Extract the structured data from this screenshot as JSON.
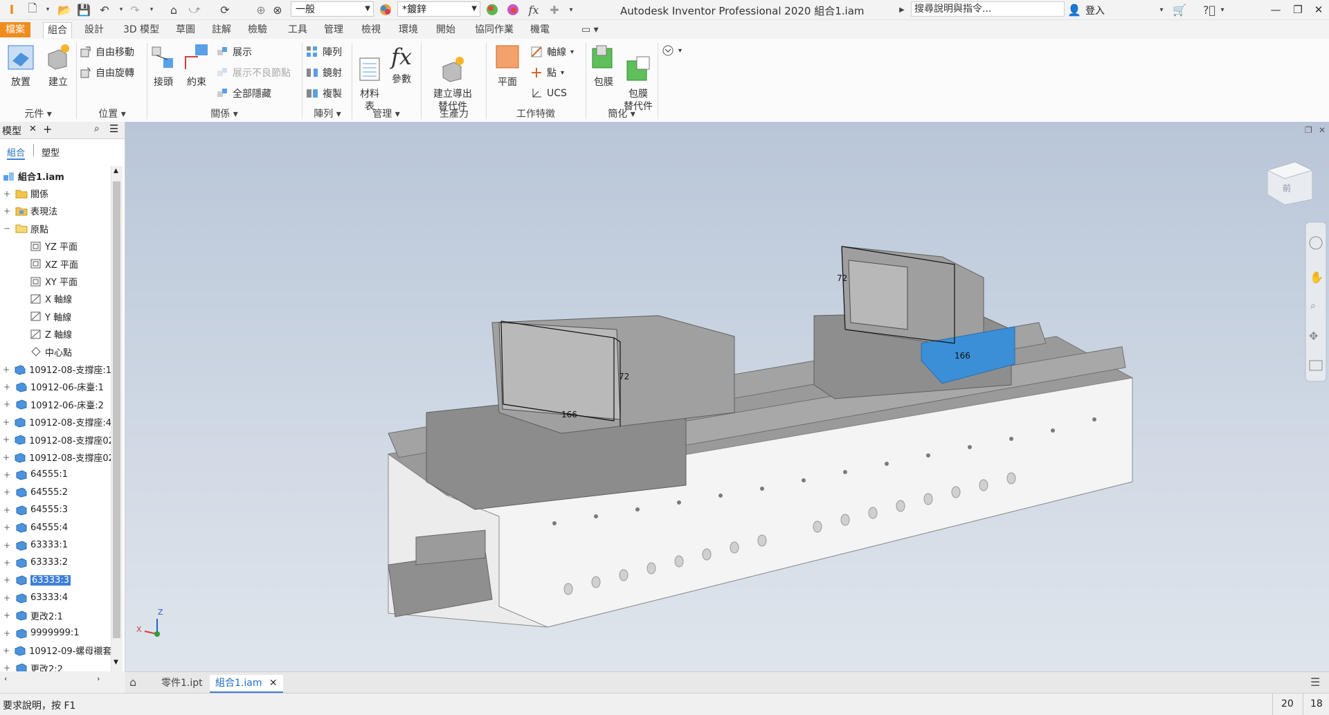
{
  "titlebar": {
    "app_title": "Autodesk Inventor Professional 2020  組合1.iam",
    "style_select": "一般",
    "material_select": "*鍍鋅",
    "search_placeholder": "搜尋說明與指令...",
    "login": "登入"
  },
  "tabs": [
    "檔案",
    "組合",
    "設計",
    "3D 模型",
    "草圖",
    "註解",
    "檢驗",
    "工具",
    "管理",
    "檢視",
    "環境",
    "開始",
    "協同作業",
    "機電"
  ],
  "active_tab": "組合",
  "ribbon": {
    "component": {
      "place": "放置",
      "create": "建立",
      "label": "元件"
    },
    "position": {
      "free_move": "自由移動",
      "free_rotate": "自由旋轉",
      "label": "位置"
    },
    "relationships": {
      "joint": "接頭",
      "constrain": "約束",
      "show": "展示",
      "show_sick": "展示不良節點",
      "hide_all": "全部隱藏",
      "label": "關係"
    },
    "pattern": {
      "pattern": "陣列",
      "mirror": "鏡射",
      "copy": "複製",
      "label": "陣列"
    },
    "manage": {
      "bom": "材料\n表",
      "params": "參數",
      "label": "管理"
    },
    "productivity": {
      "derive": "建立導出\n替代件",
      "label": "生產力"
    },
    "work_features": {
      "plane": "平面",
      "axis": "軸線",
      "point": "點",
      "ucs": "UCS",
      "label": "工作特徵"
    },
    "simplification": {
      "shrinkwrap": "包膜",
      "shrinkwrap_sub": "包膜\n替代件",
      "label": "簡化"
    }
  },
  "browser": {
    "header": "模型",
    "view_tabs": [
      "組合",
      "塑型"
    ],
    "root": "組合1.iam",
    "items": [
      {
        "label": "關係",
        "icon": "folder",
        "level": 1,
        "exp": "+"
      },
      {
        "label": "表現法",
        "icon": "folder-rep",
        "level": 1,
        "exp": "+"
      },
      {
        "label": "原點",
        "icon": "folder-open",
        "level": 1,
        "exp": "−"
      },
      {
        "label": "YZ 平面",
        "icon": "plane",
        "level": 2,
        "exp": ""
      },
      {
        "label": "XZ 平面",
        "icon": "plane",
        "level": 2,
        "exp": ""
      },
      {
        "label": "XY 平面",
        "icon": "plane",
        "level": 2,
        "exp": ""
      },
      {
        "label": "X 軸線",
        "icon": "axis",
        "level": 2,
        "exp": ""
      },
      {
        "label": "Y 軸線",
        "icon": "axis",
        "level": 2,
        "exp": ""
      },
      {
        "label": "Z 軸線",
        "icon": "axis",
        "level": 2,
        "exp": ""
      },
      {
        "label": "中心點",
        "icon": "point",
        "level": 2,
        "exp": ""
      },
      {
        "label": "10912-08-支撐座:1",
        "icon": "part-edit",
        "level": 1,
        "exp": "+"
      },
      {
        "label": "10912-06-床臺:1",
        "icon": "part-edit",
        "level": 1,
        "exp": "+"
      },
      {
        "label": "10912-06-床臺:2",
        "icon": "part",
        "level": 1,
        "exp": "+"
      },
      {
        "label": "10912-08-支撐座:4",
        "icon": "part",
        "level": 1,
        "exp": "+"
      },
      {
        "label": "10912-08-支撐座02",
        "icon": "part",
        "level": 1,
        "exp": "+"
      },
      {
        "label": "10912-08-支撐座02",
        "icon": "part",
        "level": 1,
        "exp": "+"
      },
      {
        "label": "64555:1",
        "icon": "part",
        "level": 1,
        "exp": "+"
      },
      {
        "label": "64555:2",
        "icon": "part-edit",
        "level": 1,
        "exp": "+"
      },
      {
        "label": "64555:3",
        "icon": "part",
        "level": 1,
        "exp": "+"
      },
      {
        "label": "64555:4",
        "icon": "part",
        "level": 1,
        "exp": "+"
      },
      {
        "label": "63333:1",
        "icon": "part",
        "level": 1,
        "exp": "+"
      },
      {
        "label": "63333:2",
        "icon": "part",
        "level": 1,
        "exp": "+"
      },
      {
        "label": "63333:3",
        "icon": "part",
        "level": 1,
        "exp": "+",
        "selected": true
      },
      {
        "label": "63333:4",
        "icon": "part",
        "level": 1,
        "exp": "+"
      },
      {
        "label": "更改2:1",
        "icon": "part",
        "level": 1,
        "exp": "+"
      },
      {
        "label": "9999999:1",
        "icon": "part",
        "level": 1,
        "exp": "+"
      },
      {
        "label": "10912-09-螺母襯套",
        "icon": "part",
        "level": 1,
        "exp": "+"
      },
      {
        "label": "更改2:2",
        "icon": "part",
        "level": 1,
        "exp": "+"
      },
      {
        "label": "10912-09-螺母襯套",
        "icon": "part",
        "level": 1,
        "exp": "+"
      }
    ]
  },
  "viewport": {
    "dim_left_width": "166",
    "dim_left_height": "72",
    "dim_right_width": "166",
    "dim_right_height": "72",
    "triad_x": "X",
    "triad_z": "Z"
  },
  "doc_tabs": [
    "零件1.ipt",
    "組合1.iam"
  ],
  "status": {
    "help": "要求說明，按 F1",
    "count1": "20",
    "count2": "18"
  },
  "colors": {
    "file_tab": "#f08b1d",
    "selection": "#3d7fd6",
    "highlight_part": "#3b8fd6"
  }
}
